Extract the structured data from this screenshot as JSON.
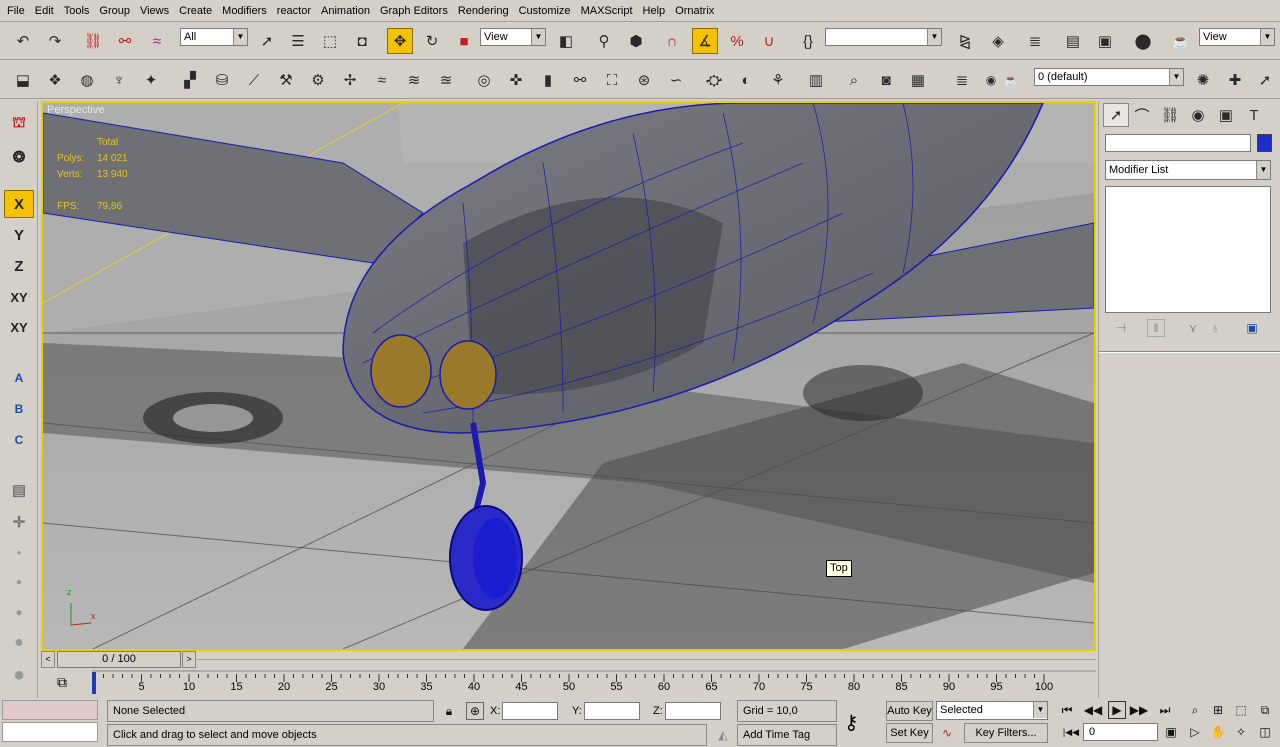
{
  "menu": [
    "File",
    "Edit",
    "Tools",
    "Group",
    "Views",
    "Create",
    "Modifiers",
    "reactor",
    "Animation",
    "Graph Editors",
    "Rendering",
    "Customize",
    "MAXScript",
    "Help",
    "Ornatrix"
  ],
  "toolbar1": {
    "selection_filter": "All",
    "ref_coord": "View",
    "named_selection": "",
    "view_right": "View"
  },
  "toolbar2": {
    "layer": "0 (default)"
  },
  "viewport": {
    "label": "Perspective",
    "stats_total": "Total",
    "polys_label": "Polys:",
    "polys_value": "14 021",
    "verts_label": "Verts:",
    "verts_value": "13 940",
    "fps_label": "FPS:",
    "fps_value": "79,86",
    "tooltip": "Top",
    "axis_z": "z",
    "axis_x": "x"
  },
  "left_toolbar": {
    "x": "X",
    "y": "Y",
    "z": "Z",
    "xy": "XY",
    "xy2": "XY",
    "a": "A",
    "b": "B",
    "c": "C"
  },
  "command_panel": {
    "name_value": "",
    "modifier_list": "Modifier List",
    "color": "#1c2ec4"
  },
  "timeline": {
    "frame_display": "0 / 100",
    "ticks": [
      "5",
      "10",
      "15",
      "20",
      "25",
      "30",
      "35",
      "40",
      "45",
      "50",
      "55",
      "60",
      "65",
      "70",
      "75",
      "80",
      "85",
      "90",
      "95",
      "100"
    ]
  },
  "status": {
    "selection": "None Selected",
    "prompt": "Click and drag to select and move objects",
    "x_label": "X:",
    "y_label": "Y:",
    "z_label": "Z:",
    "x_value": "",
    "y_value": "",
    "z_value": "",
    "grid": "Grid = 10,0",
    "add_time_tag": "Add Time Tag",
    "auto_key": "Auto Key",
    "set_key": "Set Key",
    "key_mode": "Selected",
    "key_filters": "Key Filters...",
    "current_frame": "0"
  }
}
